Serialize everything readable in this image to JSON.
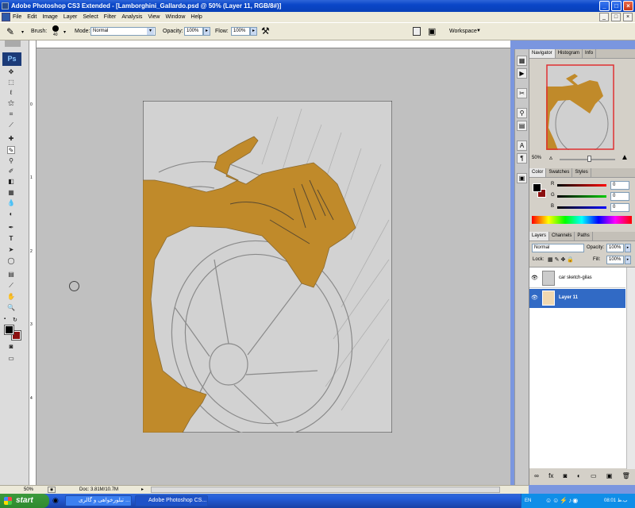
{
  "window": {
    "title": "Adobe Photoshop CS3 Extended - [Lamborghini_Gallardo.psd @ 50% (Layer 11, RGB/8#)]"
  },
  "menu": [
    "File",
    "Edit",
    "Image",
    "Layer",
    "Select",
    "Filter",
    "Analysis",
    "View",
    "Window",
    "Help"
  ],
  "options": {
    "brush_label": "Brush:",
    "brush_size": "40",
    "mode_label": "Mode:",
    "mode_value": "Normal",
    "opacity_label": "Opacity:",
    "opacity_value": "100%",
    "flow_label": "Flow:",
    "flow_value": "100%",
    "workspace_label": "Workspace"
  },
  "toolbox": {
    "logo": "Ps"
  },
  "ruler_left_numbers": [
    "0",
    "1",
    "2",
    "3",
    "4"
  ],
  "navigator": {
    "tabs": [
      "Navigator",
      "Histogram",
      "Info"
    ],
    "zoom": "50%"
  },
  "color_panel": {
    "tabs": [
      "Color",
      "Swatches",
      "Styles"
    ],
    "channels": [
      {
        "label": "R",
        "value": "0"
      },
      {
        "label": "G",
        "value": "0"
      },
      {
        "label": "B",
        "value": "0"
      }
    ]
  },
  "layers_panel": {
    "tabs": [
      "Layers",
      "Channels",
      "Paths"
    ],
    "blend_mode": "Normal",
    "opacity_label": "Opacity:",
    "opacity_value": "100%",
    "lock_label": "Lock:",
    "fill_label": "Fill:",
    "fill_value": "100%",
    "layers": [
      {
        "name": "car sketch-gilas",
        "selected": false
      },
      {
        "name": "Layer 11",
        "selected": true
      }
    ]
  },
  "status": {
    "zoom": "50%",
    "doc": "Doc: 3.81M/10.7M"
  },
  "taskbar": {
    "start": "start",
    "tasks": [
      "تبلورخواهی و گالری ...",
      "Adobe Photoshop CS..."
    ],
    "lang": "EN",
    "clock": "08:01 ب.ظ"
  },
  "colors": {
    "paint": "#c08a2a",
    "selected_layer": "#316ac5"
  }
}
